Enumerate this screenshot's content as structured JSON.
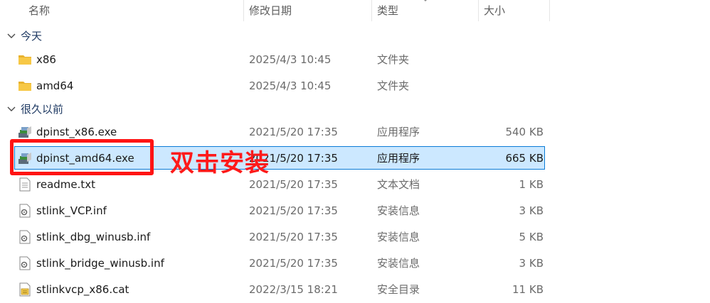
{
  "columns": {
    "name": "名称",
    "modified": "修改日期",
    "type": "类型",
    "size": "大小"
  },
  "groups": {
    "today": "今天",
    "long_ago": "很久以前"
  },
  "files": [
    {
      "name": "x86",
      "date": "2025/4/3 10:45",
      "type": "文件夹",
      "size": "",
      "icon": "folder-icon"
    },
    {
      "name": "amd64",
      "date": "2025/4/3 10:45",
      "type": "文件夹",
      "size": "",
      "icon": "folder-icon"
    },
    {
      "name": "dpinst_x86.exe",
      "date": "2021/5/20 17:35",
      "type": "应用程序",
      "size": "540 KB",
      "icon": "installer-exe-icon"
    },
    {
      "name": "dpinst_amd64.exe",
      "date": "2021/5/20 17:35",
      "type": "应用程序",
      "size": "665 KB",
      "icon": "installer-exe-icon"
    },
    {
      "name": "readme.txt",
      "date": "2021/5/20 17:35",
      "type": "文本文档",
      "size": "1 KB",
      "icon": "text-file-icon"
    },
    {
      "name": "stlink_VCP.inf",
      "date": "2021/5/20 17:35",
      "type": "安装信息",
      "size": "3 KB",
      "icon": "setup-info-icon"
    },
    {
      "name": "stlink_dbg_winusb.inf",
      "date": "2021/5/20 17:35",
      "type": "安装信息",
      "size": "5 KB",
      "icon": "setup-info-icon"
    },
    {
      "name": "stlink_bridge_winusb.inf",
      "date": "2021/5/20 17:35",
      "type": "安装信息",
      "size": "3 KB",
      "icon": "setup-info-icon"
    },
    {
      "name": "stlinkvcp_x86.cat",
      "date": "2022/3/15 18:21",
      "type": "安全目录",
      "size": "11 KB",
      "icon": "security-catalog-icon"
    }
  ],
  "annotation": "双击安装",
  "colors": {
    "selection_bg": "#cce8ff",
    "selection_border": "#0a7bd6",
    "highlight_red": "#ff1414",
    "folder_yellow": "#f7c846"
  }
}
